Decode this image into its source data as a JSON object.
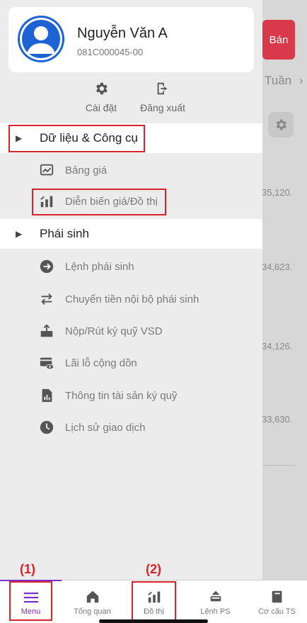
{
  "background": {
    "sell_label": "Bán",
    "period_label": "Tuần",
    "values": [
      "35,120.",
      "34,623.",
      "34,126.",
      "33,630."
    ]
  },
  "profile": {
    "name": "Nguyễn Văn A",
    "account_id": "081C000045-00"
  },
  "quick_actions": {
    "settings_label": "Cài đặt",
    "logout_label": "Đăng xuất"
  },
  "sections": {
    "data_tools": {
      "label": "Dữ liệu & Công cụ",
      "items": [
        {
          "label": "Bảng giá",
          "icon": "price-board-icon"
        },
        {
          "label": "Diễn biến giá/Đồ thị",
          "icon": "chart-bars-icon"
        }
      ]
    },
    "derivatives": {
      "label": "Phái sinh",
      "items": [
        {
          "label": "Lệnh phái sinh",
          "icon": "arrow-circle-icon"
        },
        {
          "label": "Chuyển tiền nội bộ phái sinh",
          "icon": "transfer-icon"
        },
        {
          "label": "Nộp/Rút ký quỹ VSD",
          "icon": "deposit-icon"
        },
        {
          "label": "Lãi lỗ cộng dồn",
          "icon": "card-eye-icon"
        },
        {
          "label": "Thông tin tài sản ký quỹ",
          "icon": "document-chart-icon"
        },
        {
          "label": "Lịch sử giao dịch",
          "icon": "clock-icon"
        }
      ]
    }
  },
  "bottom_nav": [
    {
      "label": "Menu",
      "icon": "menu-icon",
      "active": true
    },
    {
      "label": "Tổng quan",
      "icon": "home-icon",
      "active": false
    },
    {
      "label": "Đồ thị",
      "icon": "chart-bars-icon",
      "active": false
    },
    {
      "label": "Lệnh PS",
      "icon": "orders-icon",
      "active": false
    },
    {
      "label": "Cơ cấu TS",
      "icon": "book-icon",
      "active": false
    }
  ],
  "annotations": {
    "one": "(1)",
    "two": "(2)"
  },
  "colors": {
    "accent": "#7b2fd1",
    "sell": "#d83a4c",
    "highlight": "#d8232a",
    "avatar": "#1e63d6"
  }
}
